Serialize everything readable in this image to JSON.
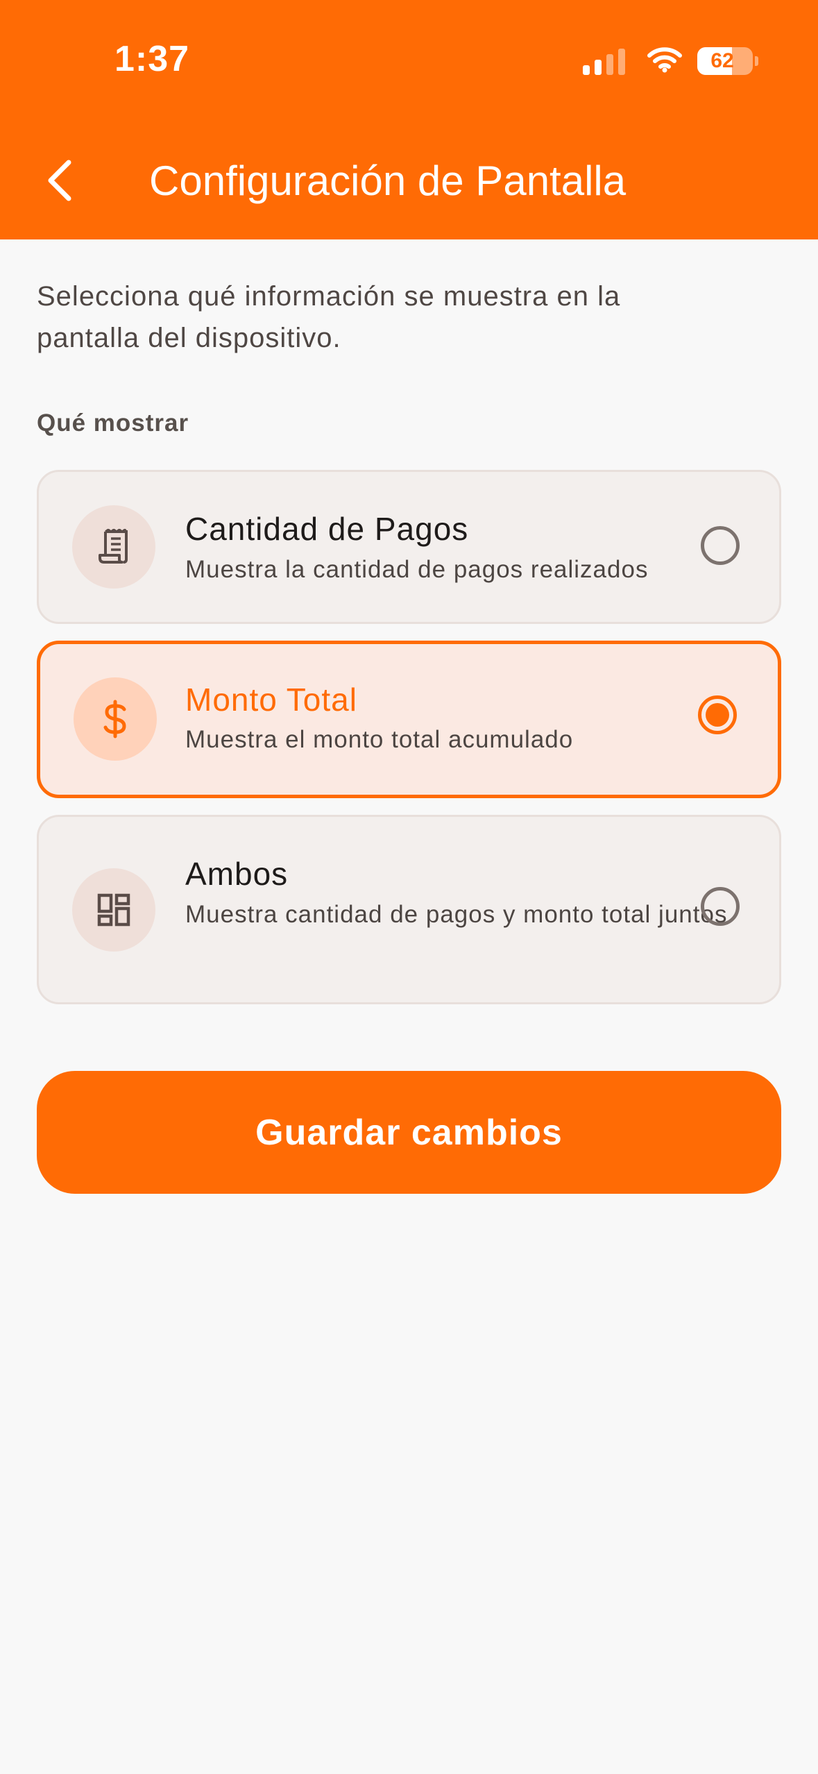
{
  "status_bar": {
    "time": "1:37",
    "battery": "62",
    "battery_level": 0.62
  },
  "header": {
    "title": "Configuración de Pantalla",
    "back_icon": "chevron-left-icon"
  },
  "description": "Selecciona qué información se muestra en la pantalla del dispositivo.",
  "section_label": "Qué mostrar",
  "options": [
    {
      "title": "Cantidad de Pagos",
      "description": "Muestra la cantidad de pagos realizados",
      "icon": "receipt-icon",
      "selected": false
    },
    {
      "title": "Monto Total",
      "description": "Muestra el monto total acumulado",
      "icon": "dollar-icon",
      "selected": true
    },
    {
      "title": "Ambos",
      "description": "Muestra cantidad de pagos y monto total juntos",
      "icon": "dashboard-icon",
      "selected": false
    }
  ],
  "save_button": "Guardar cambios",
  "colors": {
    "accent": "#ff6b05",
    "background": "#f8f8f8",
    "selected_background": "#fbe9e2"
  }
}
